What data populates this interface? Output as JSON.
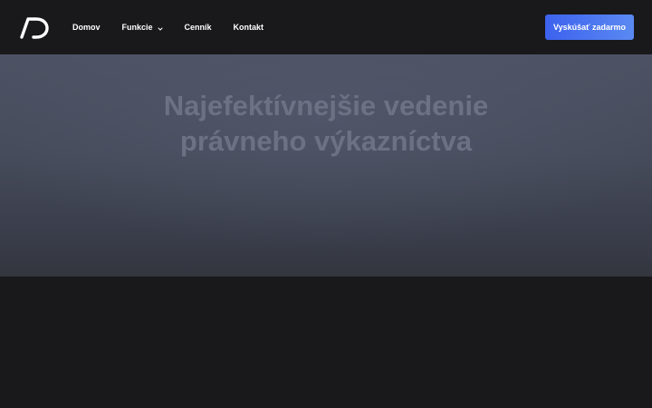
{
  "header": {
    "logo_icon": "ad-logo-icon",
    "nav": [
      {
        "label": "Domov"
      },
      {
        "label": "Funkcie",
        "icon": "chevron-down-icon"
      },
      {
        "label": "Cenník"
      },
      {
        "label": "Kontakt"
      }
    ],
    "cta_label": "Vyskúšať zadarmo"
  },
  "hero": {
    "title_line1": "Najefektívnejšie vedenie",
    "title_line2": "právneho výkazníctva"
  },
  "colors": {
    "nav_background": "#19191c",
    "cta_gradient_start": "#3d62ee",
    "cta_gradient_end": "#5a89f2",
    "hero_background": "#4c5263",
    "hero_title": "#6c7283",
    "page_background": "#19191c"
  }
}
